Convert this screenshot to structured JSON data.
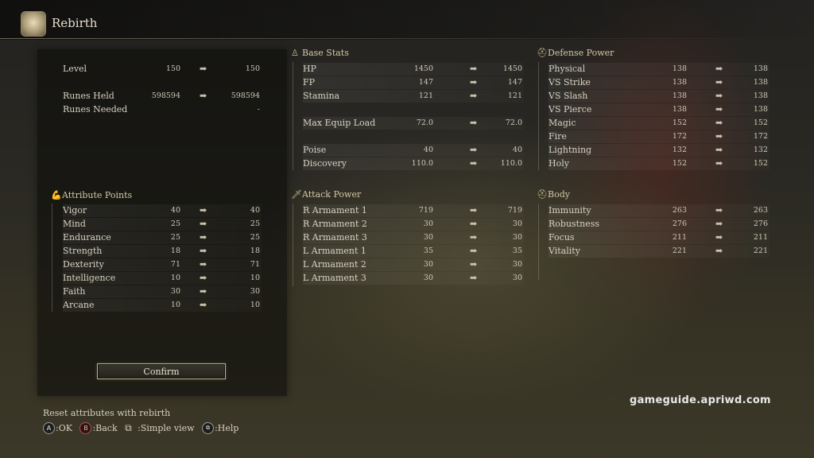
{
  "header": {
    "title": "Rebirth",
    "icon": "rebirth-stone-icon"
  },
  "level_block": {
    "rows": [
      {
        "label": "Level",
        "current": "150",
        "next": "150"
      },
      {
        "label": "Runes Held",
        "current": "598594",
        "next": "598594"
      },
      {
        "label": "Runes Needed",
        "current": "",
        "next": "-"
      }
    ]
  },
  "attributes": {
    "title": "Attribute Points",
    "icon": "flexed-arm-icon",
    "rows": [
      {
        "label": "Vigor",
        "current": "40",
        "next": "40"
      },
      {
        "label": "Mind",
        "current": "25",
        "next": "25"
      },
      {
        "label": "Endurance",
        "current": "25",
        "next": "25"
      },
      {
        "label": "Strength",
        "current": "18",
        "next": "18"
      },
      {
        "label": "Dexterity",
        "current": "71",
        "next": "71"
      },
      {
        "label": "Intelligence",
        "current": "10",
        "next": "10"
      },
      {
        "label": "Faith",
        "current": "30",
        "next": "30"
      },
      {
        "label": "Arcane",
        "current": "10",
        "next": "10"
      }
    ]
  },
  "base_stats": {
    "title": "Base Stats",
    "icon": "person-figure-icon",
    "rows": [
      {
        "label": "HP",
        "current": "1450",
        "next": "1450"
      },
      {
        "label": "FP",
        "current": "147",
        "next": "147"
      },
      {
        "label": "Stamina",
        "current": "121",
        "next": "121"
      },
      {
        "label": "Max Equip Load",
        "current": "72.0",
        "next": "72.0"
      },
      {
        "label": "Poise",
        "current": "40",
        "next": "40"
      },
      {
        "label": "Discovery",
        "current": "110.0",
        "next": "110.0"
      }
    ]
  },
  "attack_power": {
    "title": "Attack Power",
    "icon": "sword-icon",
    "rows": [
      {
        "label": "R Armament 1",
        "current": "719",
        "next": "719"
      },
      {
        "label": "R Armament 2",
        "current": "30",
        "next": "30"
      },
      {
        "label": "R Armament 3",
        "current": "30",
        "next": "30"
      },
      {
        "label": "L Armament 1",
        "current": "35",
        "next": "35"
      },
      {
        "label": "L Armament 2",
        "current": "30",
        "next": "30"
      },
      {
        "label": "L Armament 3",
        "current": "30",
        "next": "30"
      }
    ]
  },
  "defense_power": {
    "title": "Defense Power",
    "icon": "helmet-icon",
    "rows": [
      {
        "label": "Physical",
        "current": "138",
        "next": "138"
      },
      {
        "label": "VS Strike",
        "current": "138",
        "next": "138"
      },
      {
        "label": "VS Slash",
        "current": "138",
        "next": "138"
      },
      {
        "label": "VS Pierce",
        "current": "138",
        "next": "138"
      },
      {
        "label": "Magic",
        "current": "152",
        "next": "152"
      },
      {
        "label": "Fire",
        "current": "172",
        "next": "172"
      },
      {
        "label": "Lightning",
        "current": "132",
        "next": "132"
      },
      {
        "label": "Holy",
        "current": "152",
        "next": "152"
      }
    ]
  },
  "body": {
    "title": "Body",
    "icon": "helmet-icon",
    "rows": [
      {
        "label": "Immunity",
        "current": "263",
        "next": "263"
      },
      {
        "label": "Robustness",
        "current": "276",
        "next": "276"
      },
      {
        "label": "Focus",
        "current": "211",
        "next": "211"
      },
      {
        "label": "Vitality",
        "current": "221",
        "next": "221"
      }
    ]
  },
  "confirm_label": "Confirm",
  "footer": {
    "hint": "Reset attributes with rebirth",
    "controls": [
      {
        "button": "A",
        "icon": "a-button-icon",
        "label": ":OK"
      },
      {
        "button": "B",
        "icon": "b-button-icon",
        "label": ":Back"
      },
      {
        "button": "",
        "icon": "simple-view-icon",
        "label": ":Simple view"
      },
      {
        "button": "",
        "icon": "help-button-icon",
        "label": ":Help"
      }
    ]
  },
  "watermark": "gameguide.apriwd.com",
  "arrow": "➡"
}
